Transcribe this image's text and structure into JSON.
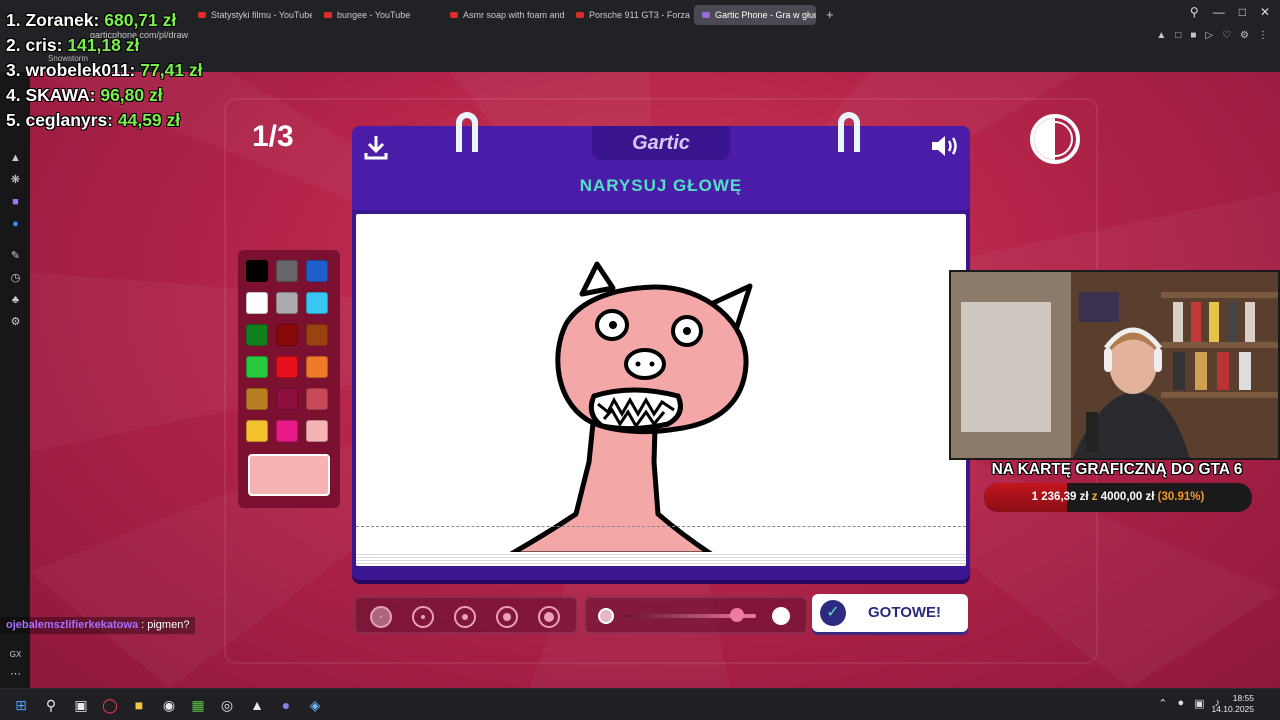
{
  "browser": {
    "tabs": [
      {
        "title": "Statystyki filmu - YouTube"
      },
      {
        "title": "bungee - YouTube"
      },
      {
        "title": "Asmr soap with foam and"
      },
      {
        "title": "Porsche 911 GT3 - Forza"
      },
      {
        "title": "Gartic Phone - Gra w głuc"
      }
    ],
    "new_tab": "+",
    "url": "garticphone.com/pl/draw",
    "bookmark": "Snowstorm"
  },
  "leaderboard": [
    {
      "rank_name": "1. Zoranek:",
      "amount": "680,71 zł"
    },
    {
      "rank_name": "2. cris:",
      "amount": "141,18 zł"
    },
    {
      "rank_name": "3. wrobelek011:",
      "amount": "77,41 zł"
    },
    {
      "rank_name": "4. SKAWA:",
      "amount": "96,80 zł"
    },
    {
      "rank_name": "5. ceglanyrs:",
      "amount": "44,59 zł"
    }
  ],
  "game": {
    "round": "1/3",
    "logo": "Gartic",
    "prompt": "NARYSUJ GŁOWĘ",
    "done_label": "GOTOWE!",
    "palette": [
      "#000000",
      "#666666",
      "#1f5fc9",
      "#ffffff",
      "#aaaaaa",
      "#38c7f2",
      "#12801e",
      "#8a0a0a",
      "#9a4310",
      "#26c93e",
      "#e6101c",
      "#f07a28",
      "#b87f22",
      "#8e0f3e",
      "#c84a5a",
      "#f5c02e",
      "#ea1a8a",
      "#f6b3b3"
    ],
    "selected_color": "#f6b3b3",
    "stroke_sizes": 5,
    "selected_size_index": 0,
    "opacity_level": 0.85
  },
  "stream": {
    "goal_title": "NA KARTĘ GRAFICZNĄ DO GTA 6",
    "goal_current": "1 236,39 zł",
    "goal_z": "z",
    "goal_target": "4000,00 zł",
    "goal_percent": "(30.91%)",
    "goal_fraction": 0.3091
  },
  "chat": {
    "user": "ojebalemszlifierkekatowa",
    "separator": ":",
    "message": "pigmen?"
  },
  "sidebar_bottom_label": "GX",
  "taskbar": {
    "time": "18:55",
    "date": "14.10.2025"
  },
  "colors": {
    "accent": "#3a1690",
    "prompt": "#52e0c4",
    "background": "#b4244a"
  }
}
